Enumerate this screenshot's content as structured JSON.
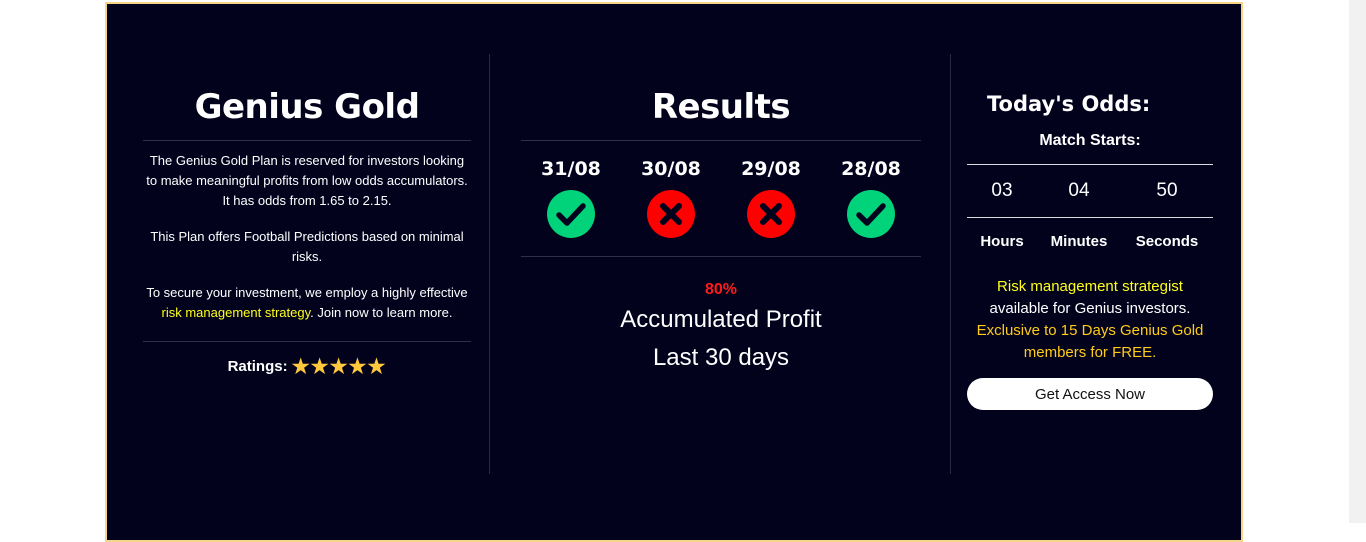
{
  "left": {
    "title": "Genius Gold",
    "para1": "The Genius Gold Plan is reserved for investors looking to make meaningful profits from low odds accumulators. It has odds from 1.65 to 2.15.",
    "para2": "This Plan offers Football Predictions based on minimal risks.",
    "para3_pre": "To secure your investment, we employ a highly effective ",
    "para3_link": "risk management strategy",
    "para3_post": ". Join now to learn more.",
    "ratings_label": "Ratings:",
    "rating_stars": 5
  },
  "middle": {
    "title": "Results",
    "results": [
      {
        "date": "31/08",
        "outcome": "win",
        "icon": "check-icon"
      },
      {
        "date": "30/08",
        "outcome": "loss",
        "icon": "cross-icon"
      },
      {
        "date": "29/08",
        "outcome": "loss",
        "icon": "cross-icon"
      },
      {
        "date": "28/08",
        "outcome": "win",
        "icon": "check-icon"
      }
    ],
    "profit_pct": "80%",
    "profit_label": "Accumulated Profit",
    "profit_period": "Last 30 days"
  },
  "right": {
    "title": "Today's Odds:",
    "match_starts": "Match Starts:",
    "hours": "03",
    "minutes": "04",
    "seconds": "50",
    "hours_label": "Hours",
    "minutes_label": "Minutes",
    "seconds_label": "Seconds",
    "promo_line1": "Risk management strategist",
    "promo_line2": "available for Genius investors.",
    "promo_line3": "Exclusive to 15 Days Genius Gold members for FREE.",
    "button_label": "Get Access Now"
  },
  "colors": {
    "background": "#02021d",
    "border": "#f5d58a",
    "win": "#00d37a",
    "loss": "#ff0000",
    "highlight": "#ffff1a",
    "star": "#ffc83d"
  }
}
